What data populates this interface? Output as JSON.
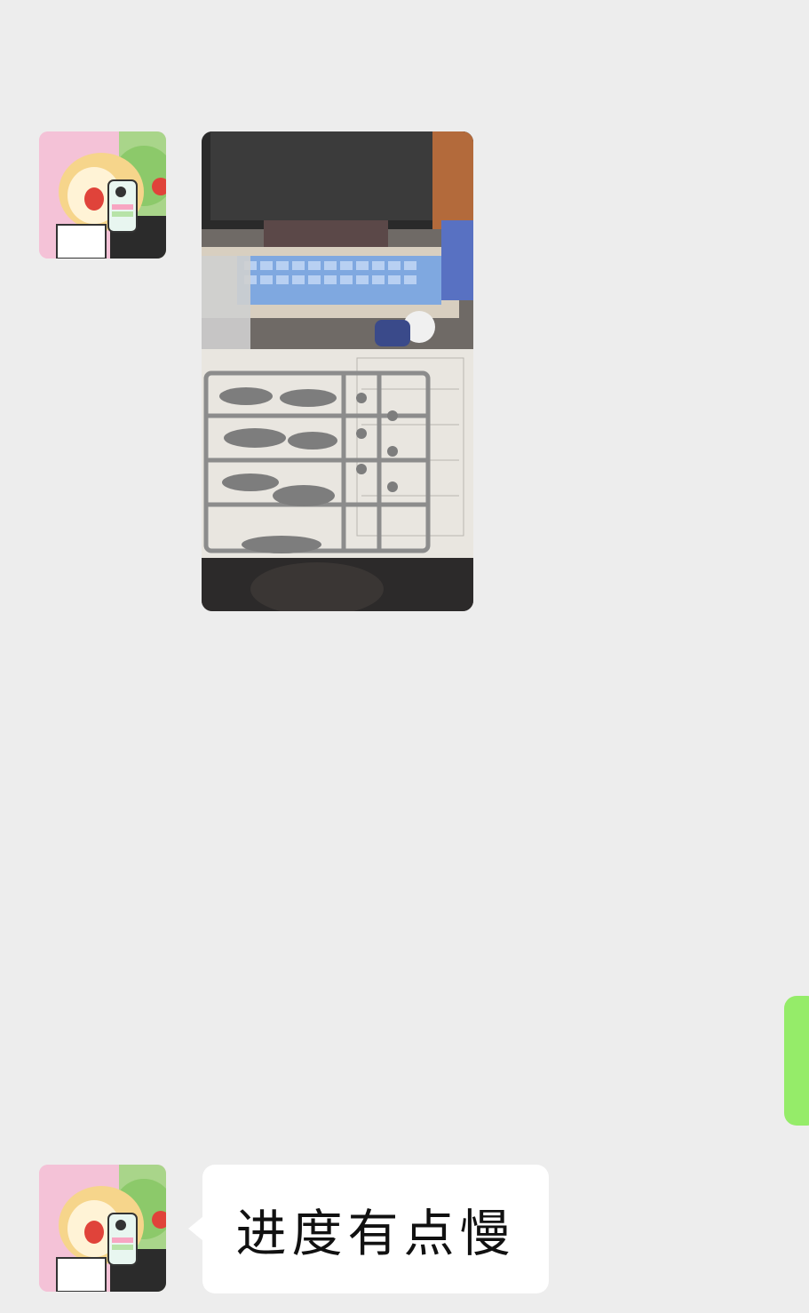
{
  "chat": {
    "messages": [
      {
        "sender": "other",
        "type": "image",
        "image_desc_icon": "photo-icon"
      },
      {
        "sender": "self",
        "type": "partial-bubble"
      },
      {
        "sender": "other",
        "type": "text",
        "text": "进度有点慢"
      }
    ]
  },
  "colors": {
    "background": "#ededed",
    "self_bubble": "#95ec69",
    "other_bubble": "#ffffff"
  }
}
